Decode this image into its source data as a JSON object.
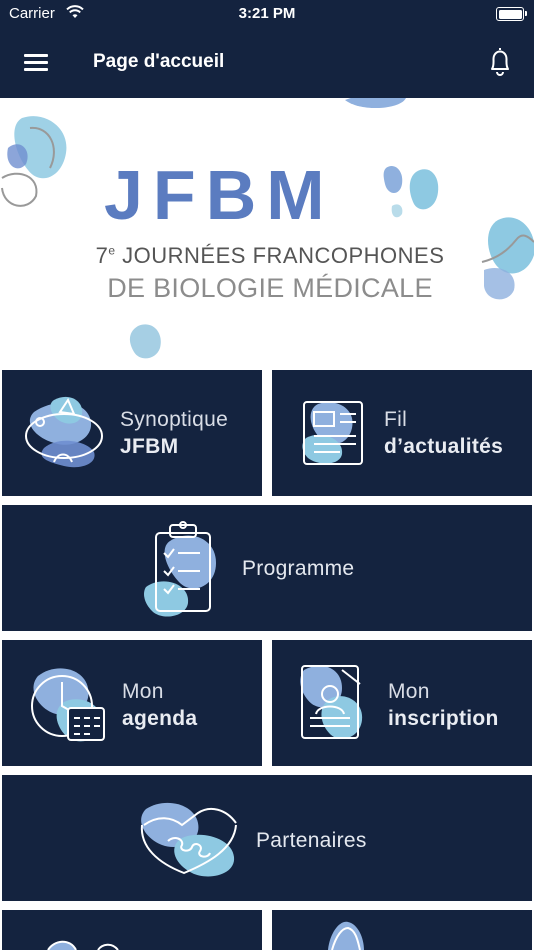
{
  "status_bar": {
    "carrier": "Carrier",
    "time": "3:21 PM"
  },
  "nav": {
    "title": "Page d'accueil",
    "menu_icon": "hamburger-icon",
    "notification_icon": "bell-icon"
  },
  "banner": {
    "logo": "JFBM",
    "subtitle_line1_prefix": "7",
    "subtitle_line1_sup": "e",
    "subtitle_line1_rest": " JOURNÉES FRANCOPHONES",
    "subtitle_line2": "DE BIOLOGIE MÉDICALE"
  },
  "tiles": {
    "synoptique": {
      "line1": "Synoptique",
      "line2": "JFBM"
    },
    "actualites": {
      "line1": "Fil",
      "line2": "d’actualités"
    },
    "programme": {
      "label": "Programme"
    },
    "agenda": {
      "line1": "Mon",
      "line2": "agenda"
    },
    "inscription": {
      "line1": "Mon",
      "line2": "inscription"
    },
    "partenaires": {
      "label": "Partenaires"
    }
  },
  "colors": {
    "navy": "#14233f",
    "brand_blue": "#5b7cc0",
    "light_blue": "#8ec9e2",
    "periwinkle": "#8fb0de"
  }
}
